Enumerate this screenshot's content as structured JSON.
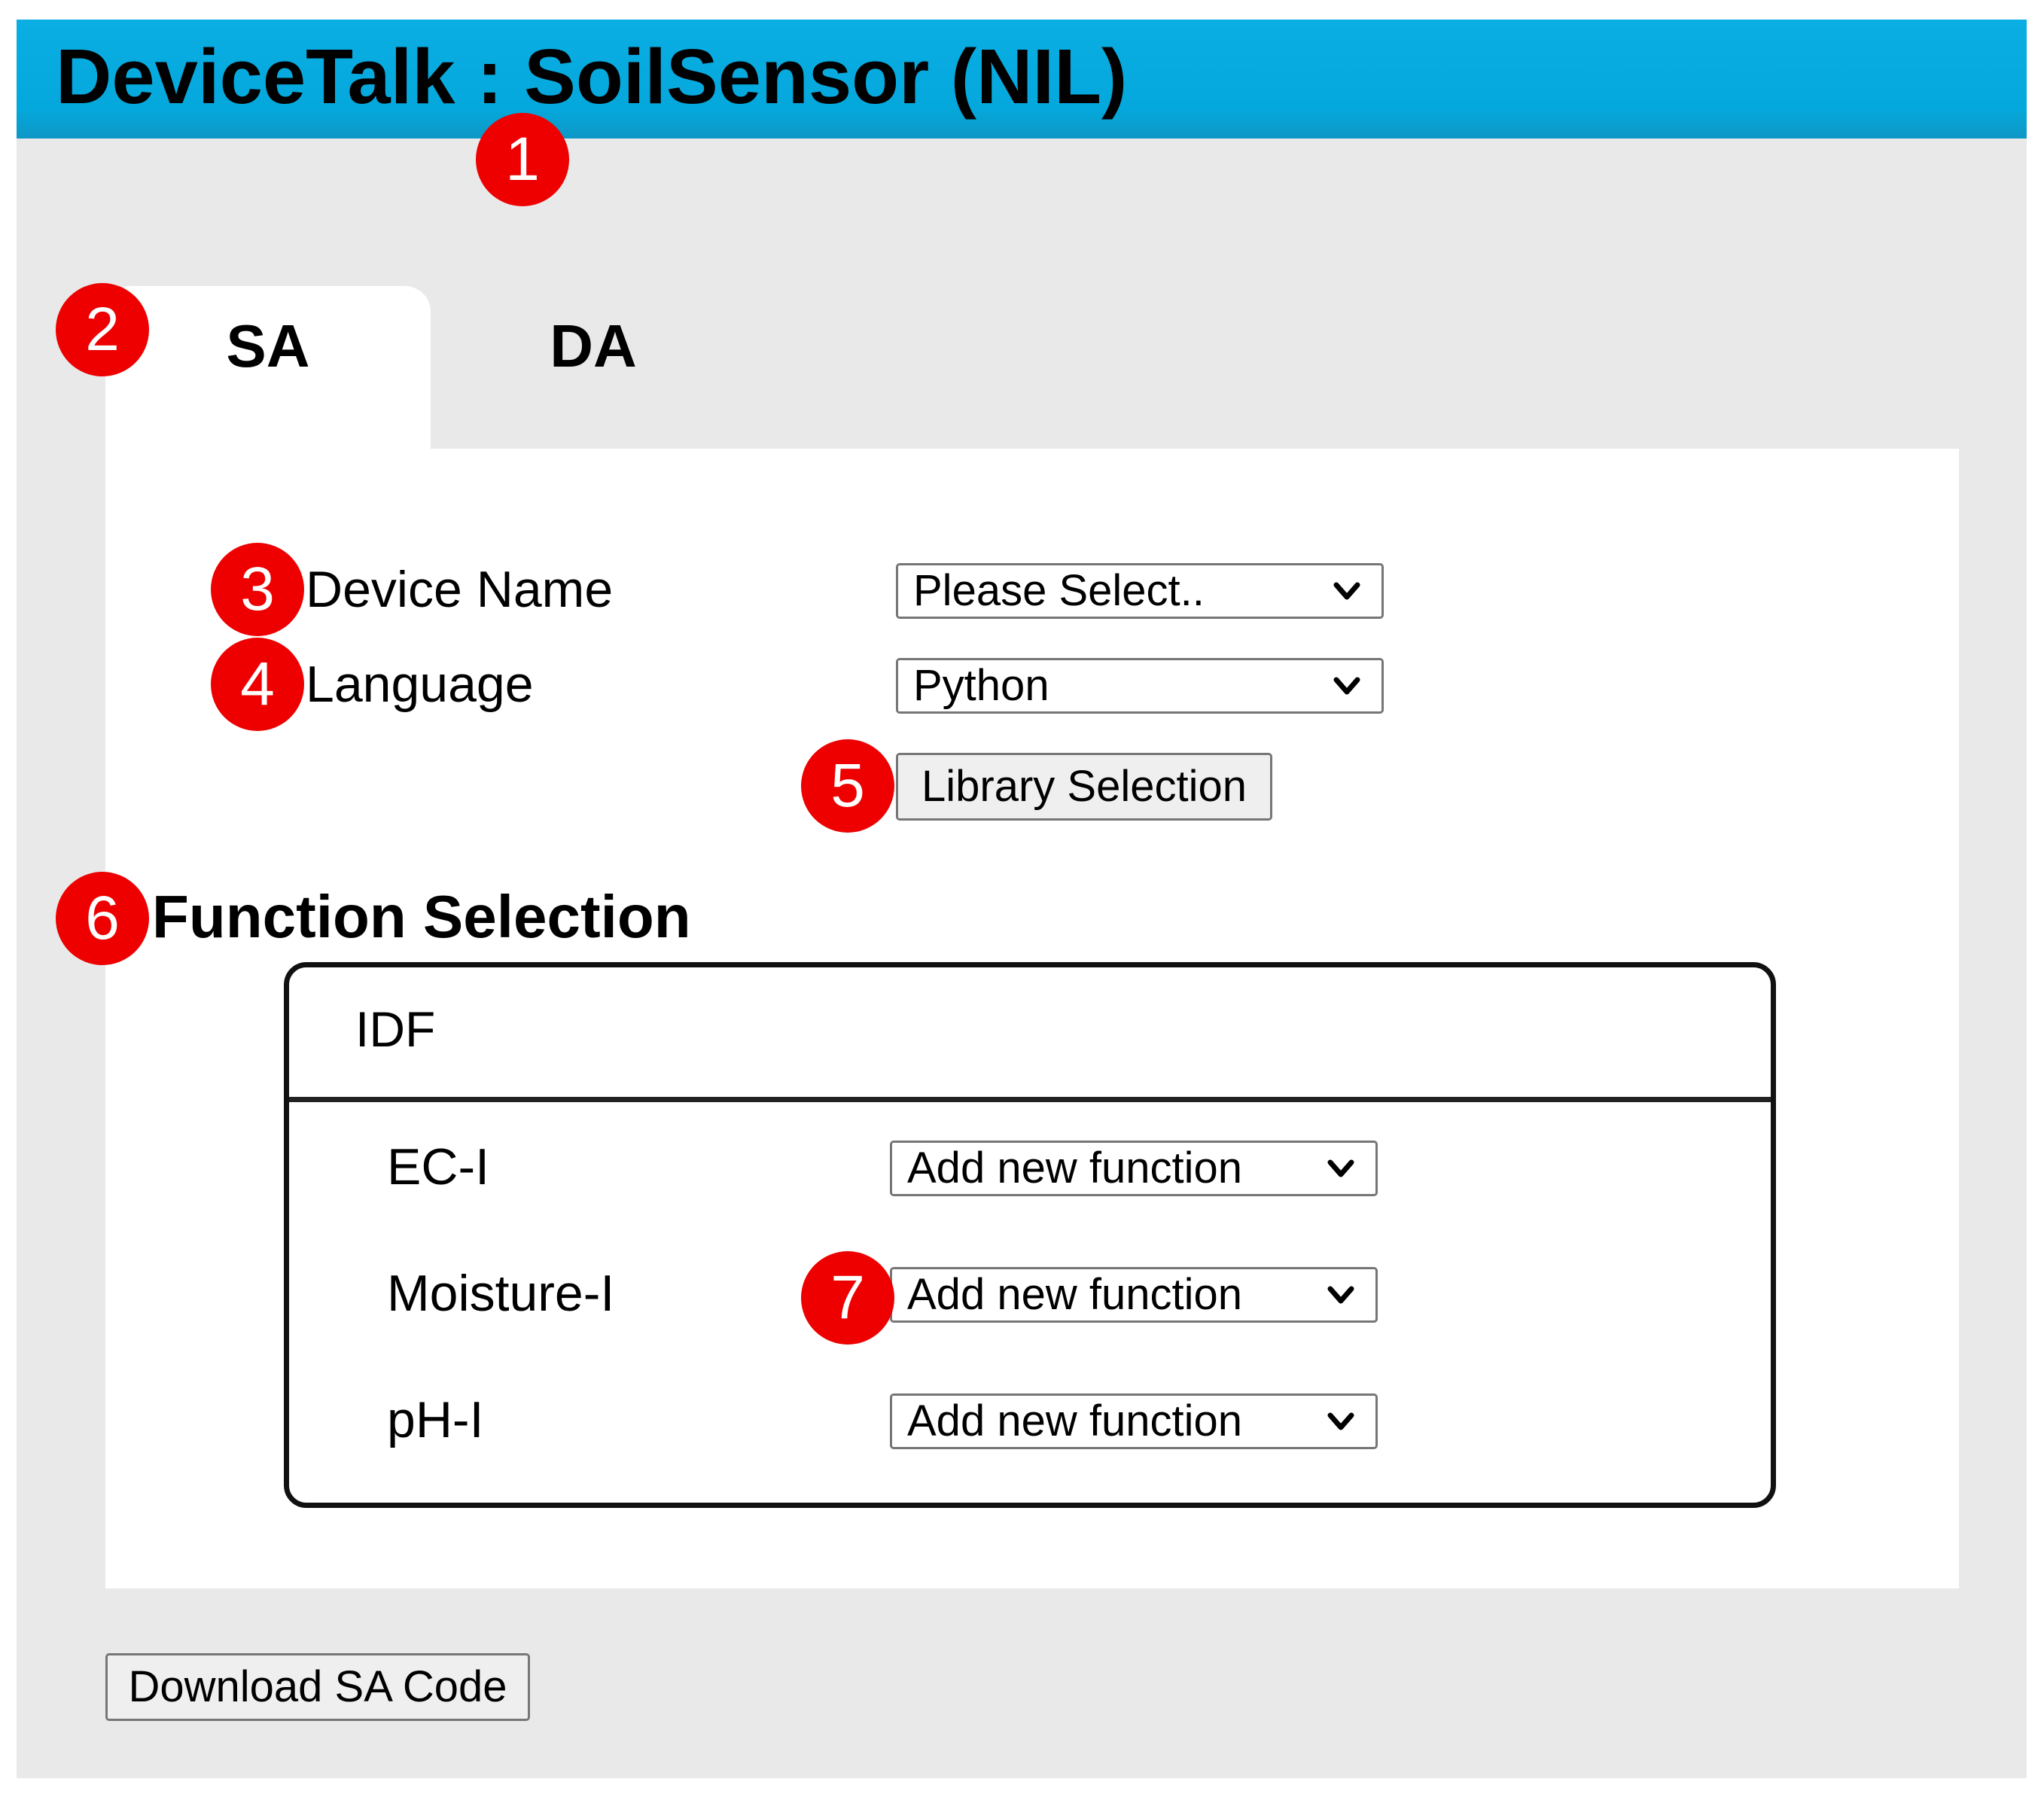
{
  "header": {
    "title": "DeviceTalk : SoilSensor (NIL)"
  },
  "tabs": [
    {
      "label": "SA",
      "active": true
    },
    {
      "label": "DA",
      "active": false
    }
  ],
  "form": {
    "device_name_label": "Device Name",
    "device_name_value": "Please Select..",
    "language_label": "Language",
    "language_value": "Python",
    "library_button": "Library Selection"
  },
  "function_selection": {
    "title": "Function Selection",
    "idf_header": "IDF",
    "rows": [
      {
        "name": "EC-I",
        "value": "Add new function"
      },
      {
        "name": "Moisture-I",
        "value": "Add new function"
      },
      {
        "name": "pH-I",
        "value": "Add new function"
      }
    ]
  },
  "download_button": "Download SA Code",
  "annotations": [
    "1",
    "2",
    "3",
    "4",
    "5",
    "6",
    "7"
  ],
  "colors": {
    "header": "#05a8dc",
    "badge": "#ee0000",
    "background": "#e9e9e9"
  }
}
